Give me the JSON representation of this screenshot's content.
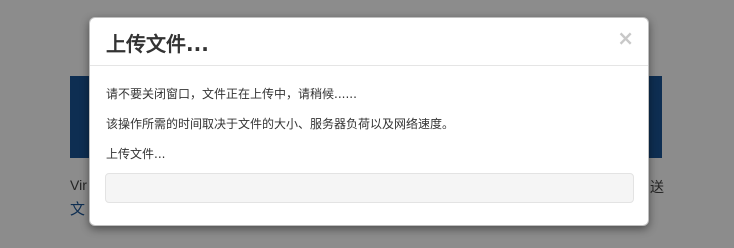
{
  "background": {
    "line_text": "Vir",
    "link_text": "文",
    "tail_text": "送",
    "banner_color": "#1a5496"
  },
  "modal": {
    "title": "上传文件...",
    "close_label": "×",
    "message_wait": "请不要关闭窗口，文件正在上传中，请稍候......",
    "message_time": "该操作所需的时间取决于文件的大小、服务器负荷以及网络速度。",
    "status_label": "上传文件...",
    "progress_fraction": 0
  }
}
